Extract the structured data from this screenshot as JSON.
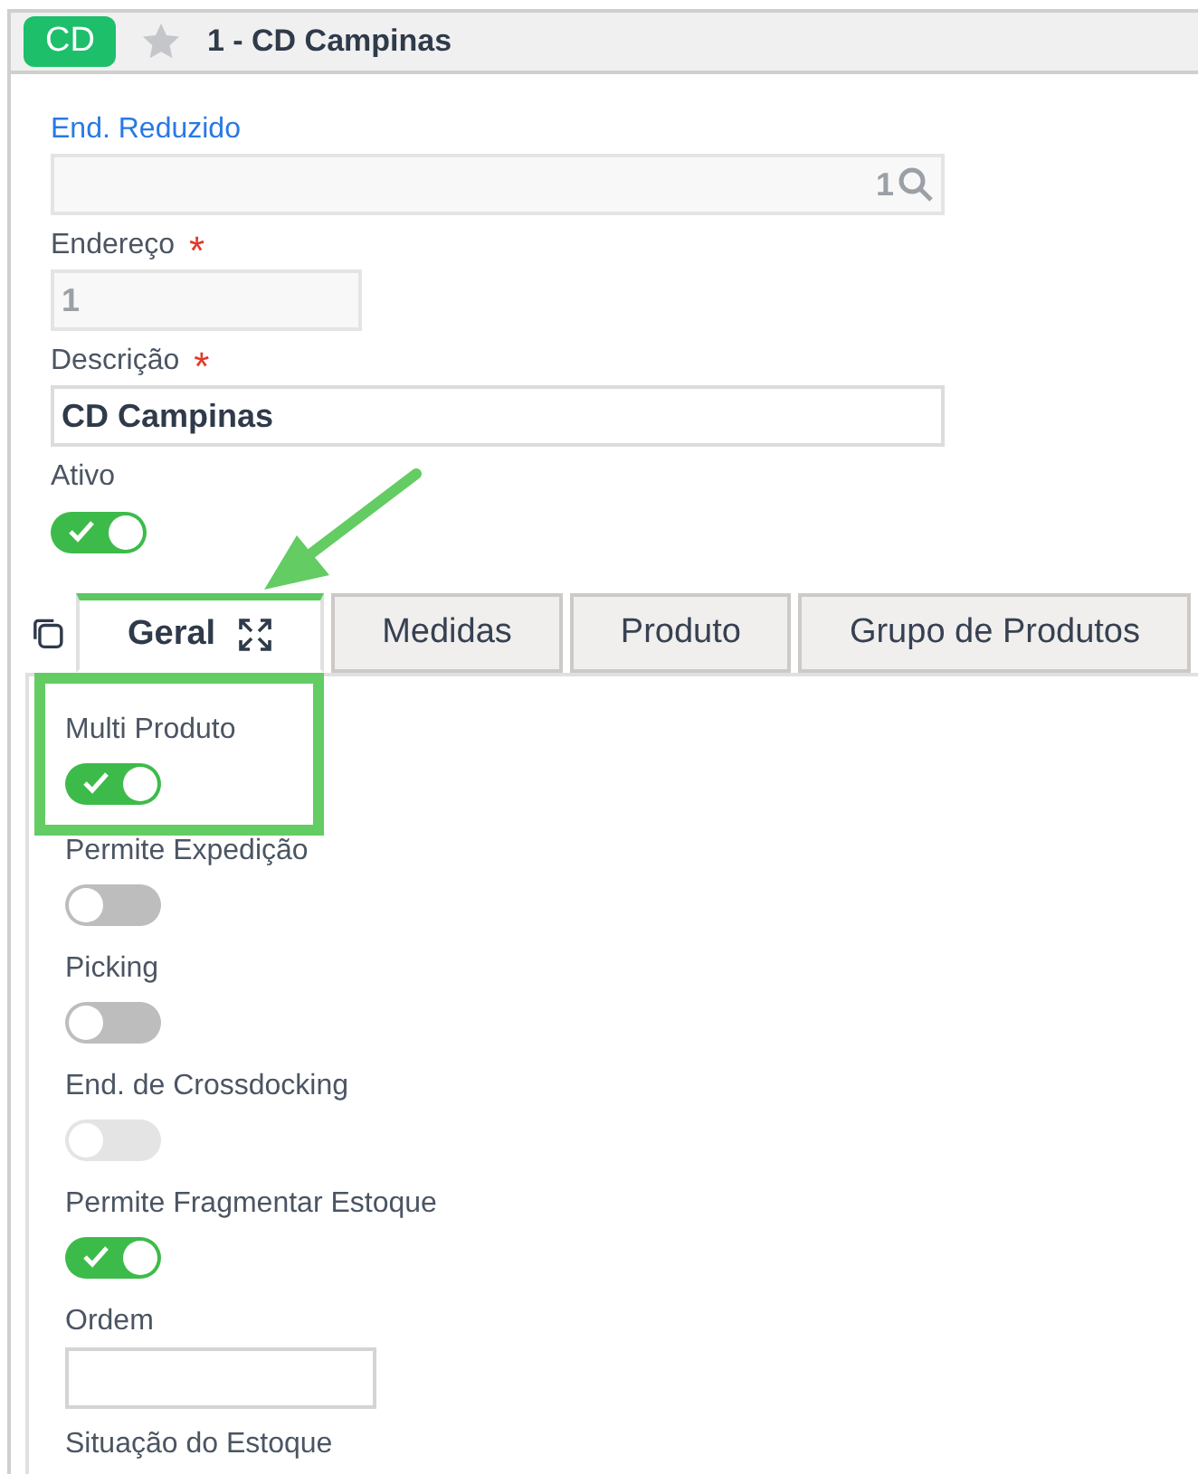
{
  "header": {
    "badge": "CD",
    "favorite": false,
    "title": "1 - CD Campinas"
  },
  "fields": [
    {
      "label": "End. Reduzido",
      "kind": "lookup",
      "link": true,
      "readonly": true,
      "value": "1"
    },
    {
      "label": "Endereço",
      "required_mark": "*",
      "kind": "short",
      "link": false,
      "readonly": true,
      "value": "1"
    },
    {
      "label": "Descrição",
      "required_mark": "*",
      "kind": "text",
      "link": false,
      "readonly": false,
      "value": "CD Campinas"
    },
    {
      "label": "Ativo",
      "kind": "toggle",
      "link": false,
      "on": true,
      "disabled": false
    }
  ],
  "tabs": [
    {
      "label": "Geral",
      "selected": true
    },
    {
      "label": "Medidas",
      "selected": false
    },
    {
      "label": "Produto",
      "selected": false
    },
    {
      "label": "Grupo de Produtos",
      "selected": false
    }
  ],
  "panel": [
    {
      "label": "Multi Produto",
      "kind": "toggle",
      "on": true,
      "disabled": false,
      "highlighted": true
    },
    {
      "label": "Permite Expedição",
      "kind": "toggle",
      "on": false,
      "disabled": false,
      "highlighted": false
    },
    {
      "label": "Picking",
      "kind": "toggle",
      "on": false,
      "disabled": false,
      "highlighted": false
    },
    {
      "label": "End. de Crossdocking",
      "kind": "toggle",
      "on": false,
      "disabled": true,
      "highlighted": false
    },
    {
      "label": "Permite Fragmentar Estoque",
      "kind": "toggle",
      "on": true,
      "disabled": false,
      "highlighted": false
    },
    {
      "label": "Ordem",
      "kind": "input",
      "highlighted": false
    },
    {
      "label": "Situação do Estoque",
      "kind": "label",
      "highlighted": false
    }
  ]
}
